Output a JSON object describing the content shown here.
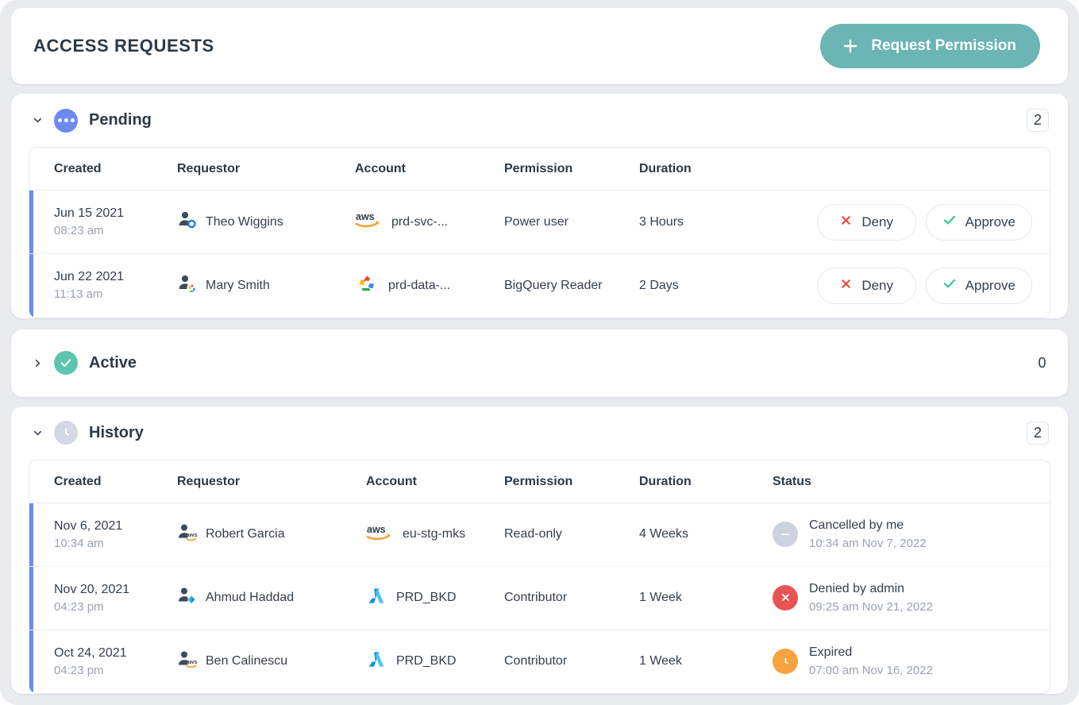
{
  "header": {
    "title": "ACCESS REQUESTS",
    "request_button": "Request Permission",
    "plus_icon": "plus-icon"
  },
  "sections": [
    {
      "id": "pending",
      "label": "Pending",
      "count": "2",
      "expanded": true,
      "chevron": "chevron-down-icon",
      "icon": "ellipsis-icon"
    },
    {
      "id": "active",
      "label": "Active",
      "count": "0",
      "expanded": false,
      "chevron": "chevron-right-icon",
      "icon": "check-circle-icon"
    },
    {
      "id": "history",
      "label": "History",
      "count": "2",
      "expanded": true,
      "chevron": "chevron-down-icon",
      "icon": "clock-icon"
    }
  ],
  "pending_table": {
    "columns": [
      "Created",
      "Requestor",
      "Account",
      "Permission",
      "Duration"
    ],
    "rows": [
      {
        "created_date": "Jun 15 2021",
        "created_time": "08:23 am",
        "requestor": "Theo Wiggins",
        "requestor_badge": "okta-ring-icon",
        "account": "prd-svc-...",
        "account_provider": "aws-icon",
        "permission": "Power user",
        "duration": "3 Hours",
        "deny": "Deny",
        "approve": "Approve"
      },
      {
        "created_date": "Jun 22 2021",
        "created_time": "11:13 am",
        "requestor": "Mary Smith",
        "requestor_badge": "gcp-icon",
        "account": "prd-data-...",
        "account_provider": "gcp-icon",
        "permission": "BigQuery Reader",
        "duration": "2 Days",
        "deny": "Deny",
        "approve": "Approve"
      }
    ]
  },
  "history_table": {
    "columns": [
      "Created",
      "Requestor",
      "Account",
      "Permission",
      "Duration",
      "Status"
    ],
    "rows": [
      {
        "created_date": "Nov 6, 2021",
        "created_time": "10:34 am",
        "requestor": "Robert Garcia",
        "requestor_badge": "aws-icon",
        "account": "eu-stg-mks",
        "account_provider": "aws-icon",
        "permission": "Read-only",
        "duration": "4 Weeks",
        "status_label": "Cancelled by me",
        "status_time": "10:34 am Nov 7, 2022",
        "status_kind": "cancelled",
        "status_icon": "minus-circle-icon"
      },
      {
        "created_date": "Nov 20, 2021",
        "created_time": "04:23 pm",
        "requestor": "Ahmud Haddad",
        "requestor_badge": "azure-icon",
        "account": "PRD_BKD",
        "account_provider": "azure-icon",
        "permission": "Contributor",
        "duration": "1 Week",
        "status_label": "Denied by admin",
        "status_time": "09:25 am Nov 21, 2022",
        "status_kind": "denied",
        "status_icon": "x-circle-icon"
      },
      {
        "created_date": "Oct 24, 2021",
        "created_time": "04:23 pm",
        "requestor": "Ben Calinescu",
        "requestor_badge": "aws-icon",
        "account": "PRD_BKD",
        "account_provider": "azure-icon",
        "permission": "Contributor",
        "duration": "1 Week",
        "status_label": "Expired",
        "status_time": "07:00 am Nov 16, 2022",
        "status_kind": "expired",
        "status_icon": "clock-circle-icon"
      }
    ]
  },
  "colors": {
    "accent_teal": "#6bb5b4",
    "row_accent_blue": "#6c8bf0",
    "pending_blue": "#6c8bf0",
    "active_green": "#5ec5ad",
    "history_gray": "#d4d8e2",
    "deny_red": "#ea4335",
    "approve_green": "#34c38f",
    "denied_red": "#ea5353",
    "expired_orange": "#f5a33e",
    "cancelled_gray": "#ccd2de"
  }
}
